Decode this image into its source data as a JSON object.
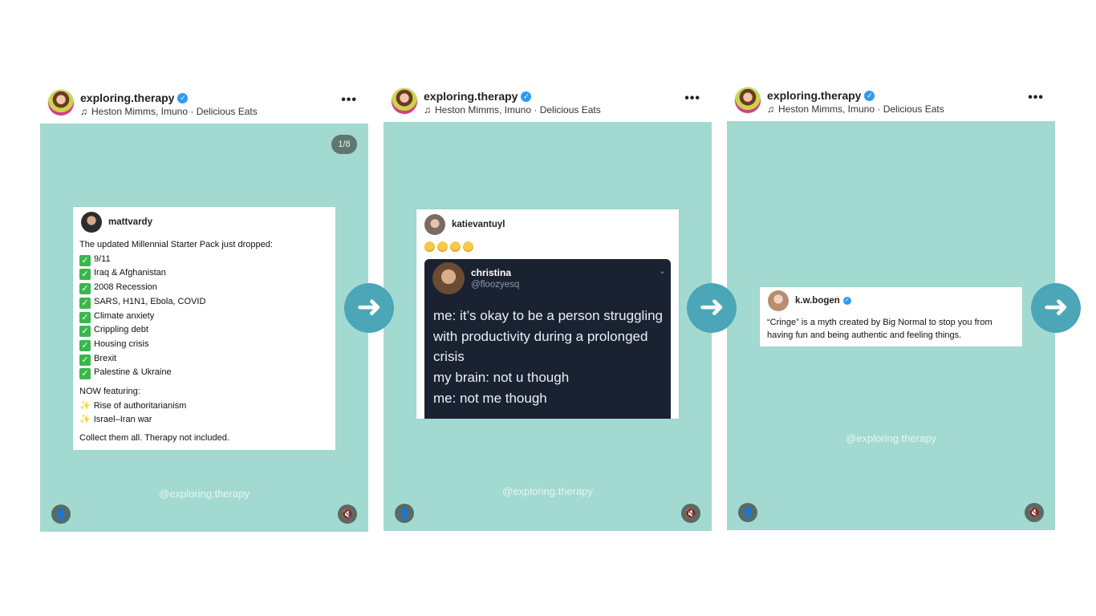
{
  "posts": [
    {
      "account": "exploring.therapy",
      "music": "Heston Mimms, Imuno · Delicious Eats",
      "counter": "1/8",
      "watermark": "@exploring.therapy",
      "tweet": {
        "user": "mattvardy",
        "intro": "The updated Millennial Starter Pack just dropped:",
        "checklist": [
          "9/11",
          "Iraq & Afghanistan",
          "2008 Recession",
          "SARS, H1N1, Ebola, COVID",
          "Climate anxiety",
          "Crippling debt",
          "Housing crisis",
          "Brexit",
          "Palestine & Ukraine"
        ],
        "now_featuring": "NOW featuring:",
        "featured": [
          "Rise of authoritarianism",
          "Israel–Iran war"
        ],
        "outro": "Collect them all. Therapy not included."
      }
    },
    {
      "account": "exploring.therapy",
      "music": "Heston Mimms, Imuno · Delicious Eats",
      "watermark": "@exploring.therapy",
      "tweet": {
        "user": "katievantuyl",
        "embedded": {
          "name": "christina",
          "handle": "@floozyesq",
          "lines": [
            "me: it’s okay to be a person struggling with productivity during a prolonged crisis",
            "my brain: not u though",
            "me: not me though"
          ]
        }
      }
    },
    {
      "account": "exploring.therapy",
      "music": "Heston Mimms, Imuno · Delicious Eats",
      "watermark": "@exploring.therapy",
      "tweet": {
        "user": "k.w.bogen",
        "text": "“Cringe” is a myth created by Big Normal to stop you from having fun and being authentic and feeling things."
      }
    }
  ],
  "icons": {
    "verified": "verified-badge-icon",
    "music": "music-note-icon",
    "more": "more-options-icon",
    "arrow": "arrow-right-icon",
    "user": "user-tag-icon",
    "mute": "muted-speaker-icon"
  },
  "colors": {
    "slide_bg": "#a2dad1",
    "arrow_bg": "#4ba6b7",
    "verified": "#2f9bf0"
  }
}
